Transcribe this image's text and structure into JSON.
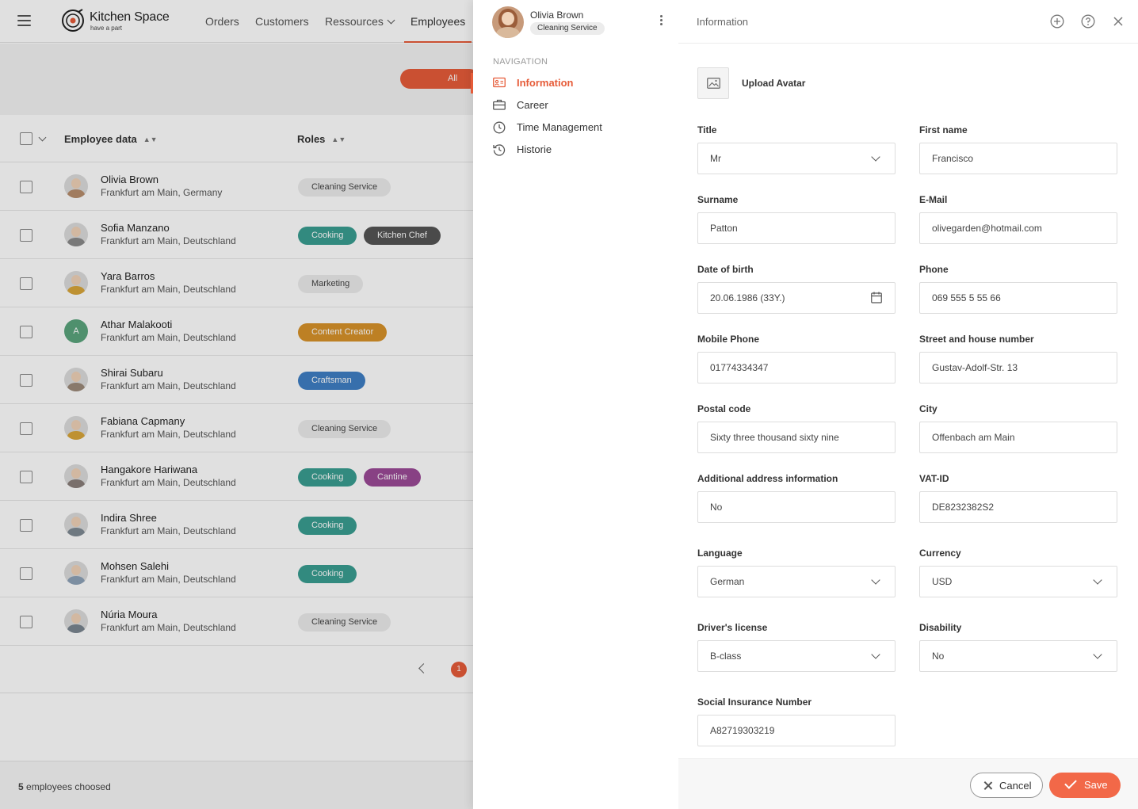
{
  "app": {
    "brand": "Kitchen Space",
    "tagline": "have a part"
  },
  "topnav": {
    "orders": "Orders",
    "customers": "Customers",
    "resources": "Ressources",
    "employees": "Employees"
  },
  "filter": {
    "all_label": "All"
  },
  "table": {
    "col_employee": "Employee data",
    "col_roles": "Roles"
  },
  "employees": [
    {
      "name": "Olivia Brown",
      "location": "Frankfurt am Main, Germany",
      "roles": [
        "Cleaning Service"
      ]
    },
    {
      "name": "Sofia Manzano",
      "location": "Frankfurt am Main, Deutschland",
      "roles": [
        "Cooking",
        "Kitchen Chef"
      ]
    },
    {
      "name": "Yara Barros",
      "location": "Frankfurt am Main, Deutschland",
      "roles": [
        "Marketing"
      ]
    },
    {
      "name": "Athar Malakooti",
      "location": "Frankfurt am Main, Deutschland",
      "roles": [
        "Content Creator"
      ],
      "initial": "A"
    },
    {
      "name": "Shirai Subaru",
      "location": "Frankfurt am Main, Deutschland",
      "roles": [
        "Craftsman"
      ]
    },
    {
      "name": "Fabiana Capmany",
      "location": "Frankfurt am Main, Deutschland",
      "roles": [
        "Cleaning Service"
      ]
    },
    {
      "name": "Hangakore Hariwana",
      "location": "Frankfurt am Main, Deutschland",
      "roles": [
        "Cooking",
        "Cantine"
      ]
    },
    {
      "name": "Indira Shree",
      "location": "Frankfurt am Main, Deutschland",
      "roles": [
        "Cooking"
      ]
    },
    {
      "name": "Mohsen Salehi",
      "location": "Frankfurt am Main, Deutschland",
      "roles": [
        "Cooking"
      ]
    },
    {
      "name": "Núria Moura",
      "location": "Frankfurt am Main, Deutschland",
      "roles": [
        "Cleaning Service"
      ]
    }
  ],
  "role_colors": {
    "Cleaning Service": {
      "bg": "#ececec",
      "fg": "#444444"
    },
    "Cooking": {
      "bg": "#3a9e91",
      "fg": "#ffffff"
    },
    "Kitchen Chef": {
      "bg": "#555555",
      "fg": "#ffffff"
    },
    "Marketing": {
      "bg": "#ececec",
      "fg": "#444444"
    },
    "Content Creator": {
      "bg": "#d8922a",
      "fg": "#ffffff"
    },
    "Craftsman": {
      "bg": "#3f7fc4",
      "fg": "#ffffff"
    },
    "Cantine": {
      "bg": "#9b4a97",
      "fg": "#ffffff"
    }
  },
  "pagination": {
    "current": "1"
  },
  "footer": {
    "count": "5",
    "text": "employees choosed"
  },
  "profile": {
    "name": "Olivia Brown",
    "role": "Cleaning Service"
  },
  "side_nav": {
    "caption": "NAVIGATION",
    "items": [
      {
        "label": "Information",
        "icon": "id-card-icon"
      },
      {
        "label": "Career",
        "icon": "briefcase-icon"
      },
      {
        "label": "Time Management",
        "icon": "clock-icon"
      },
      {
        "label": "Historie",
        "icon": "history-icon"
      }
    ]
  },
  "panel": {
    "title": "Information",
    "upload_label": "Upload Avatar"
  },
  "form": {
    "title": {
      "label": "Title",
      "value": "Mr"
    },
    "first_name": {
      "label": "First name",
      "value": "Francisco"
    },
    "surname": {
      "label": "Surname",
      "value": "Patton"
    },
    "email": {
      "label": "E-Mail",
      "value": "olivegarden@hotmail.com"
    },
    "dob": {
      "label": "Date of birth",
      "value": "20.06.1986 (33Y.)"
    },
    "phone": {
      "label": "Phone",
      "value": "069 555 5 55 66"
    },
    "mobile": {
      "label": "Mobile Phone",
      "value": "01774334347"
    },
    "street": {
      "label": "Street and house number",
      "value": "Gustav-Adolf-Str. 13"
    },
    "postal": {
      "label": "Postal code",
      "value": "Sixty three thousand sixty nine"
    },
    "city": {
      "label": "City",
      "value": "Offenbach am Main"
    },
    "additional": {
      "label": "Additional address information",
      "value": "No"
    },
    "vat": {
      "label": "VAT-ID",
      "value": "DE8232382S2"
    },
    "language": {
      "label": "Language",
      "value": "German"
    },
    "currency": {
      "label": "Currency",
      "value": "USD"
    },
    "license": {
      "label": "Driver's license",
      "value": "B-class"
    },
    "disability": {
      "label": "Disability",
      "value": "No"
    },
    "sin": {
      "label": "Social Insurance Number",
      "value": "A82719303219"
    }
  },
  "actions": {
    "cancel": "Cancel",
    "save": "Save"
  },
  "colors": {
    "accent": "#e65c39",
    "save": "#f26848"
  }
}
